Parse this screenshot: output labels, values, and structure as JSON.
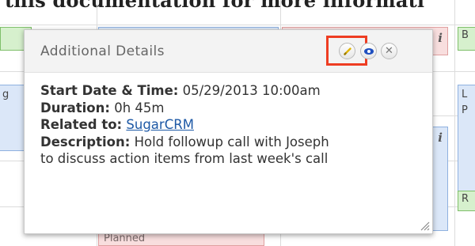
{
  "doc": {
    "heading": "this documentation for more informati"
  },
  "calendar": {
    "events": [
      {
        "label": "i"
      },
      {
        "label": "B"
      },
      {
        "label": "g"
      },
      {
        "label": "L"
      },
      {
        "label": "P"
      },
      {
        "label": "i"
      },
      {
        "label": "R"
      },
      {
        "label": "Planned"
      }
    ]
  },
  "popup": {
    "title": "Additional Details",
    "fields": {
      "start_label": "Start Date & Time:",
      "start_value": "05/29/2013 10:00am",
      "duration_label": "Duration:",
      "duration_value": "0h 45m",
      "related_label": "Related to:",
      "related_value": "SugarCRM",
      "description_label": "Description:",
      "description_line1": "Hold followup call with Joseph",
      "description_line2": "to discuss action items from last week's call"
    },
    "buttons": {
      "edit_icon": "pencil-icon",
      "view_icon": "eye-icon",
      "close_icon": "close-icon"
    },
    "highlight_color": "#ee3d22"
  }
}
